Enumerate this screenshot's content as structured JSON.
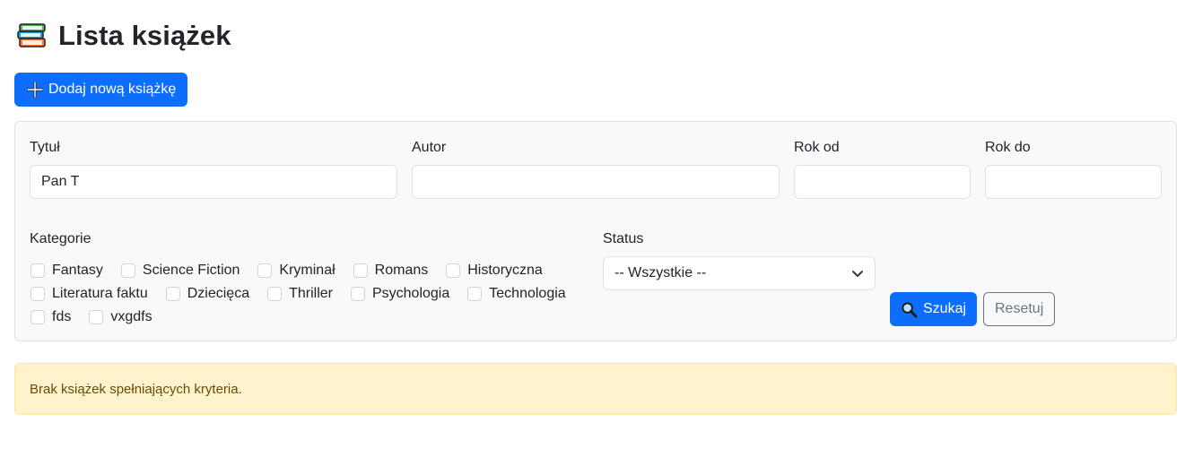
{
  "header": {
    "title": "Lista książek",
    "icon": "books-icon"
  },
  "actions": {
    "add_label": "Dodaj nową książkę",
    "add_icon": "plus-icon"
  },
  "filters": {
    "title": {
      "label": "Tytuł",
      "value": "Pan T"
    },
    "author": {
      "label": "Autor",
      "value": ""
    },
    "year_from": {
      "label": "Rok od",
      "value": ""
    },
    "year_to": {
      "label": "Rok do",
      "value": ""
    },
    "categories": {
      "label": "Kategorie",
      "rows": [
        [
          "Fantasy",
          "Science Fiction",
          "Kryminał",
          "Romans",
          "Historyczna"
        ],
        [
          "Literatura faktu",
          "Dziecięca",
          "Thriller",
          "Psychologia",
          "Technologia"
        ],
        [
          "fds",
          "vxgdfs"
        ]
      ]
    },
    "status": {
      "label": "Status",
      "selected": "-- Wszystkie --"
    },
    "search_label": "Szukaj",
    "reset_label": "Resetuj"
  },
  "alert": {
    "message": "Brak książek spełniających kryteria."
  },
  "colors": {
    "primary": "#0d6efd",
    "secondary": "#6c757d",
    "card_bg": "#f8f9fa",
    "warning_bg": "#fff3cd",
    "warning_text": "#664d03"
  }
}
